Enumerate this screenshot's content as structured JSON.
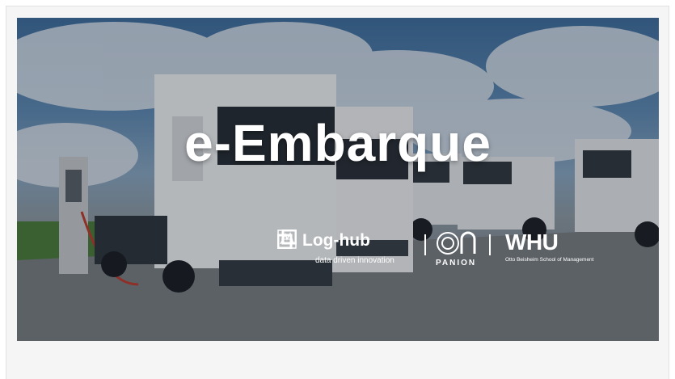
{
  "hero": {
    "title": "e-Embarque"
  },
  "logos": {
    "loghub": {
      "name": "Log-hub",
      "tagline": "data driven innovation",
      "icon": "loghub-logo-icon"
    },
    "panion": {
      "name": "PANION",
      "icon": "panion-logo-icon"
    },
    "whu": {
      "name": "WHU",
      "tagline": "Otto Beisheim School of Management",
      "icon": "whu-crest-icon"
    }
  },
  "colors": {
    "text": "#ffffff",
    "card_background": "#f5f5f5",
    "sky": "#5d89b3"
  }
}
